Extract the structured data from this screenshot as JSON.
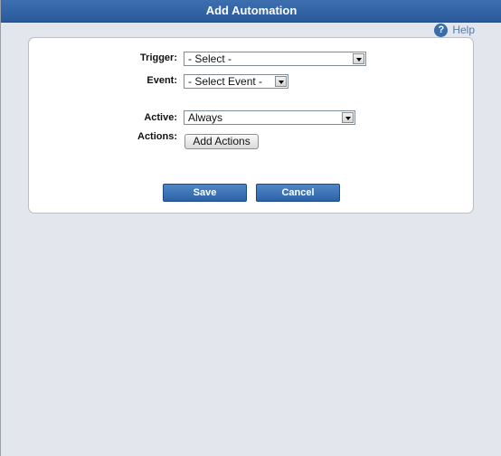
{
  "dialog": {
    "title": "Add Automation",
    "help_label": "Help",
    "help_icon": "?"
  },
  "form": {
    "trigger": {
      "label": "Trigger:",
      "value": "- Select -"
    },
    "event": {
      "label": "Event:",
      "value": "- Select Event -"
    },
    "active": {
      "label": "Active:",
      "value": "Always"
    },
    "actions": {
      "label": "Actions:",
      "button_label": "Add Actions"
    }
  },
  "footer": {
    "save_label": "Save",
    "cancel_label": "Cancel"
  },
  "colors": {
    "titlebar": "#2f62a6",
    "button_blue": "#3a70b5",
    "background": "#e3e6ec"
  }
}
